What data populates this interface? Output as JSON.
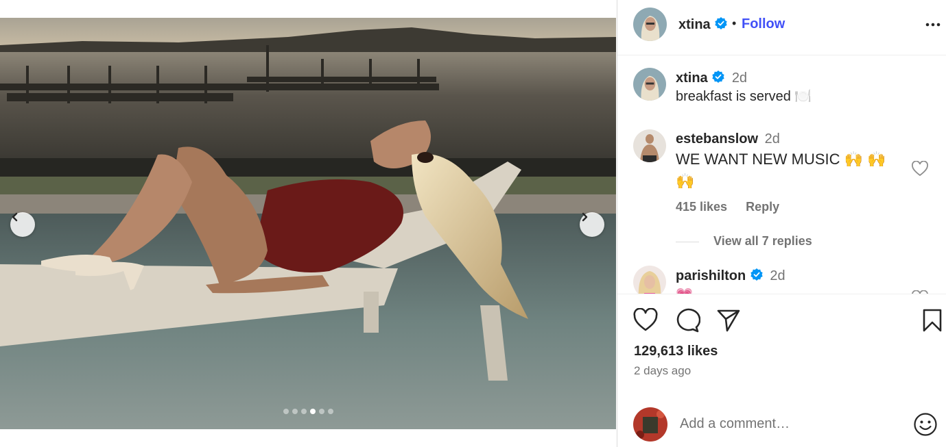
{
  "carousel": {
    "total_slides": 6,
    "active_slide": 4,
    "prev_icon": "chevron-left-icon",
    "next_icon": "chevron-right-icon"
  },
  "post": {
    "author": "xtina",
    "verified": true,
    "separator": "•",
    "follow_label": "Follow",
    "more_icon": "more-horizontal-icon",
    "caption": {
      "username": "xtina",
      "time": "2d",
      "text": "breakfast is served 🍽️"
    },
    "likes": "129,613 likes",
    "time_ago": "2 days ago"
  },
  "comments": [
    {
      "username": "estebanslow",
      "time": "2d",
      "text": "WE WANT NEW MUSIC 🙌 🙌 🙌",
      "likes": "415 likes",
      "reply_label": "Reply",
      "view_replies": "View all 7 replies"
    },
    {
      "username": "parishilton",
      "verified": true,
      "time": "2d",
      "text": "💗"
    }
  ],
  "actions": {
    "like_icon": "heart-icon",
    "comment_icon": "comment-icon",
    "share_icon": "send-icon",
    "save_icon": "bookmark-icon"
  },
  "composer": {
    "placeholder": "Add a comment…",
    "emoji_icon": "smiley-icon"
  },
  "colors": {
    "accent": "#4150f7",
    "verified": "#0095f6",
    "text": "#262626",
    "muted": "#737373",
    "border": "#dbdbdb"
  }
}
